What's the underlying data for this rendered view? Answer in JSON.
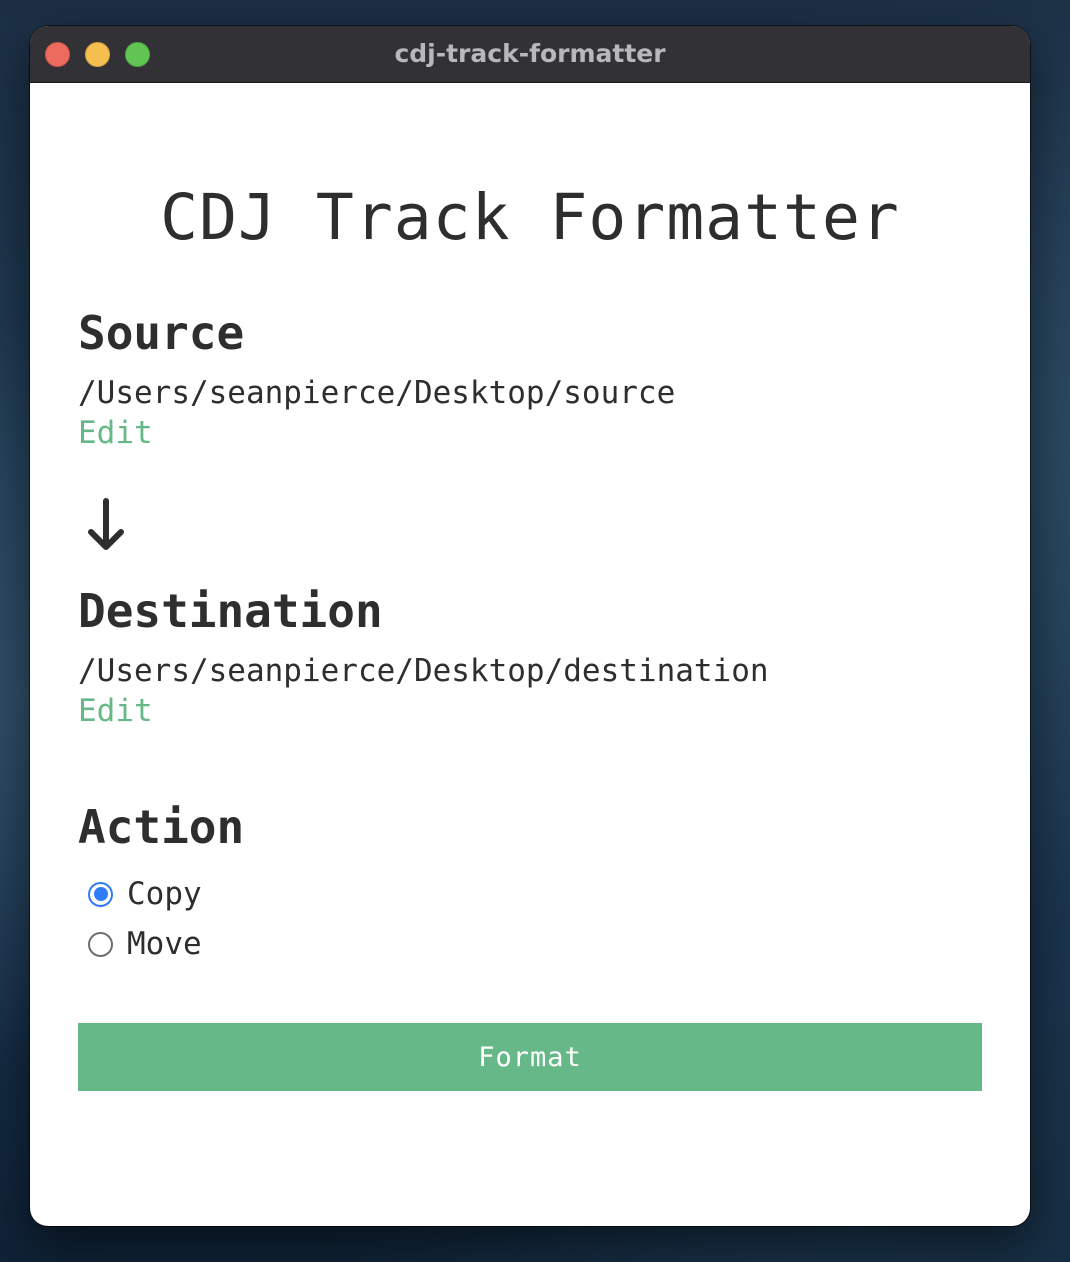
{
  "window": {
    "title": "cdj-track-formatter"
  },
  "app": {
    "title": "CDJ Track Formatter"
  },
  "source": {
    "heading": "Source",
    "path": "/Users/seanpierce/Desktop/source",
    "edit_label": "Edit"
  },
  "destination": {
    "heading": "Destination",
    "path": "/Users/seanpierce/Desktop/destination",
    "edit_label": "Edit"
  },
  "action": {
    "heading": "Action",
    "options": [
      {
        "label": "Copy",
        "selected": true
      },
      {
        "label": "Move",
        "selected": false
      }
    ]
  },
  "format_button": {
    "label": "Format"
  },
  "icons": {
    "flow_arrow": "arrow-down-icon"
  },
  "colors": {
    "accent_green": "#66b888",
    "radio_selected": "#2f7df6",
    "titlebar": "#323236",
    "text": "#2e2e2e"
  }
}
